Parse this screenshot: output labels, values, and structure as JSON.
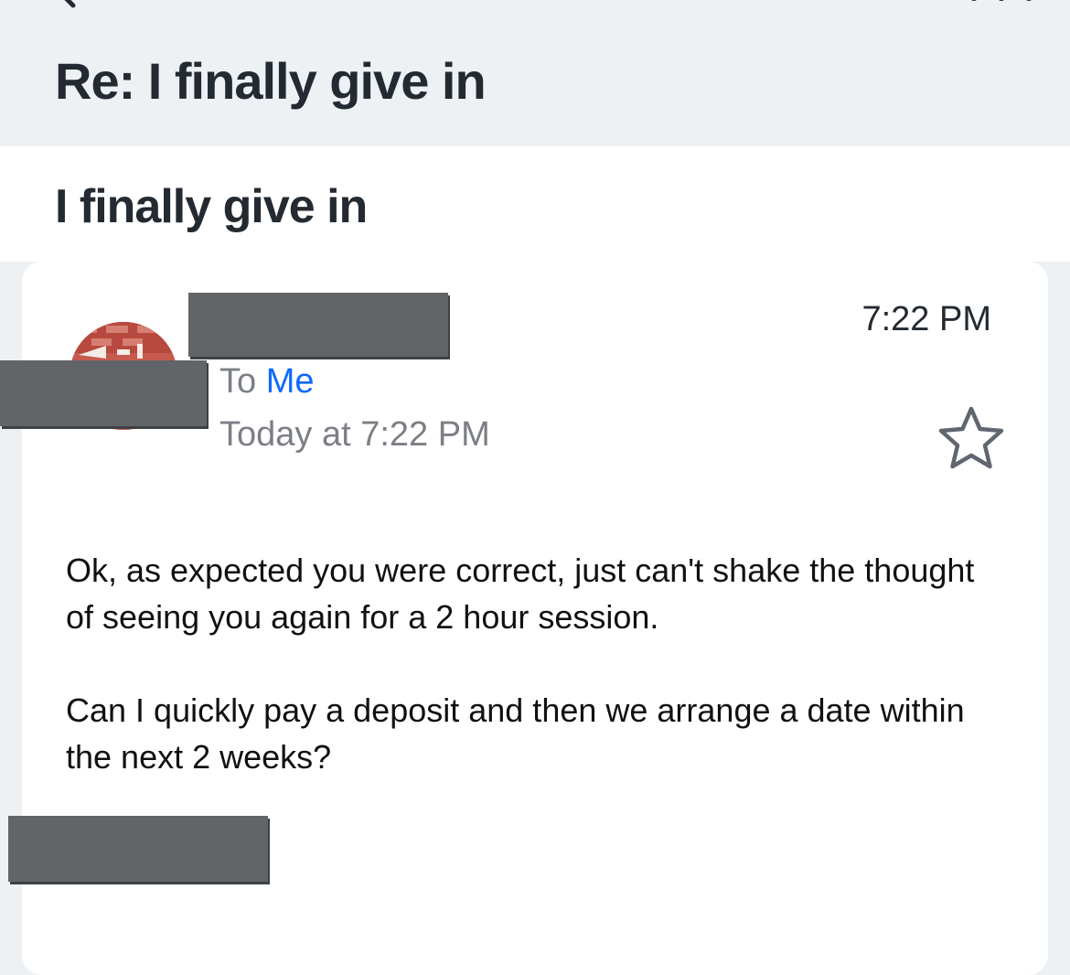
{
  "header": {
    "title": "Re: I finally give in",
    "back_icon": "chevron-left-icon",
    "more_icon": "more-horizontal-icon"
  },
  "message": {
    "subject": "I finally give in",
    "time": "7:22 PM",
    "to_prefix": "To",
    "to_recipient": "Me",
    "date": "Today at 7:22 PM",
    "star_icon": "star-outline-icon",
    "body": [
      "Ok, as expected you were correct, just can't shake the thought of seeing you again for a 2 hour session.",
      "Can I quickly pay a deposit and then we arrange a date within the next 2 weeks?"
    ]
  },
  "colors": {
    "background": "#eef1f4",
    "card": "#ffffff",
    "title_text": "#232a31",
    "secondary_text": "#7b7f85",
    "link": "#0f69ff",
    "redaction": "#626568"
  }
}
